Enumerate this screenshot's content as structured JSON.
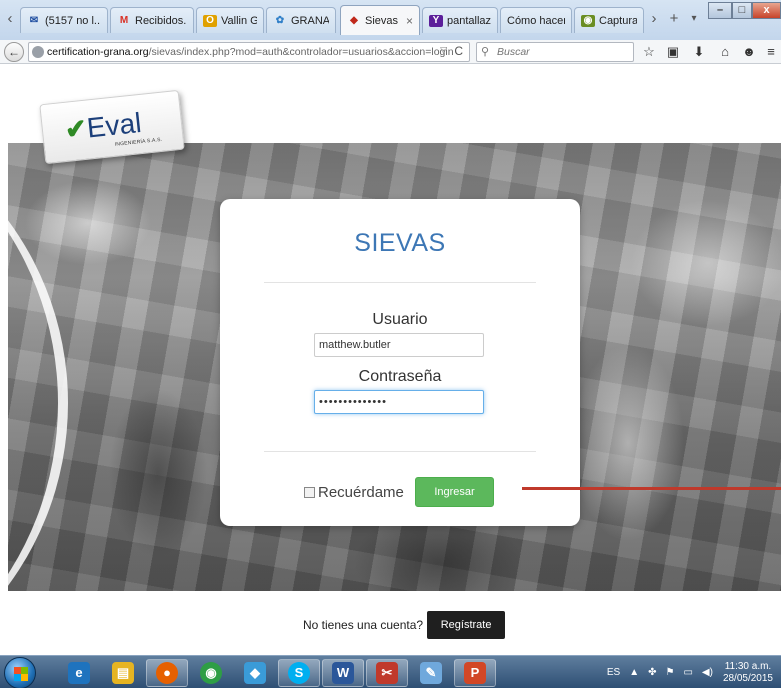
{
  "browser": {
    "tabs": [
      {
        "label": "(5157 no l...",
        "icon": "mail-icon",
        "color": "#1a4a9e"
      },
      {
        "label": "Recibidos...",
        "icon": "gmail-icon",
        "color": "#d93025"
      },
      {
        "label": "Vallin Go...",
        "icon": "outlook-icon",
        "color": "#e0a100"
      },
      {
        "label": "GRANA",
        "icon": "gear-icon",
        "color": "#2f7fc8"
      },
      {
        "label": "Sievas",
        "icon": "sievas-icon",
        "color": "#c0281b",
        "active": true
      },
      {
        "label": "pantallaz...",
        "icon": "yahoo-icon",
        "color": "#5b1f9a"
      },
      {
        "label": "Cómo hacer ...",
        "icon": "",
        "color": ""
      },
      {
        "label": "Capturar ...",
        "icon": "capture-icon",
        "color": "#6b8e23"
      }
    ],
    "url_host": "certification-grana.org",
    "url_path": "/sievas/index.php?mod=auth&controlador=usuarios&accion=login",
    "search_placeholder": "Buscar"
  },
  "logo": {
    "text": "Eval",
    "subtext": "INGENIERÍA S.A.S."
  },
  "login": {
    "title": "SIEVAS",
    "user_label": "Usuario",
    "user_value": "matthew.butler",
    "password_label": "Contraseña",
    "password_value": "••••••••••••••",
    "remember_label": "Recuérdame",
    "submit_label": "Ingresar"
  },
  "signup": {
    "prompt": "No tienes una cuenta?",
    "button": "Regístrate"
  },
  "taskbar": {
    "apps": [
      {
        "name": "ie-icon",
        "color": "#1e73be",
        "glyph": "e"
      },
      {
        "name": "explorer-icon",
        "color": "#e6b422",
        "glyph": "▤"
      },
      {
        "name": "firefox-icon",
        "color": "#e66000",
        "glyph": "●"
      },
      {
        "name": "chrome-icon",
        "color": "#2e9e45",
        "glyph": "◉"
      },
      {
        "name": "people-icon",
        "color": "#3a9bd8",
        "glyph": "◆"
      },
      {
        "name": "skype-icon",
        "color": "#00aff0",
        "glyph": "S"
      },
      {
        "name": "word-icon",
        "color": "#2b579a",
        "glyph": "W"
      },
      {
        "name": "snip-icon",
        "color": "#c0392b",
        "glyph": "✂"
      },
      {
        "name": "paint-icon",
        "color": "#6fa8dc",
        "glyph": "✎"
      },
      {
        "name": "powerpoint-icon",
        "color": "#d24726",
        "glyph": "P"
      }
    ],
    "language": "ES",
    "time": "11:30 a.m.",
    "date": "28/05/2015"
  },
  "colors": {
    "accent": "#3d77b5",
    "submit": "#5cb85c",
    "arrow": "#c0392b"
  }
}
